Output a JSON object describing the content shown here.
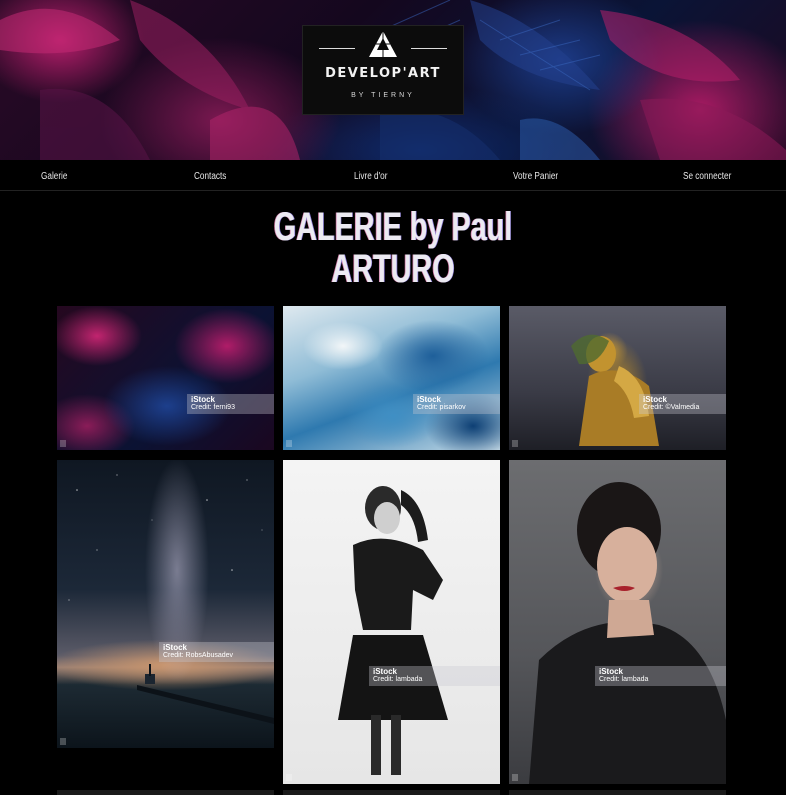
{
  "logo": {
    "title": "DEVELOP'ART",
    "subtitle": "BY TIERNY"
  },
  "nav": {
    "items": [
      {
        "label": "Galerie"
      },
      {
        "label": "Contacts"
      },
      {
        "label": "Livre d'or"
      },
      {
        "label": "Votre Panier"
      },
      {
        "label": "Se connecter"
      }
    ]
  },
  "page": {
    "title_line1": "GALERIE by Paul",
    "title_line2": "ARTURO"
  },
  "gallery": {
    "items": [
      {
        "credit_brand": "iStock",
        "credit_text": "Credit: ferni93"
      },
      {
        "credit_brand": "iStock",
        "credit_text": "Credit: pisarkov"
      },
      {
        "credit_brand": "iStock",
        "credit_text": "Credit: ©Valmedia"
      },
      {
        "credit_brand": "iStock",
        "credit_text": "Credit: RobsAbusadev"
      },
      {
        "credit_brand": "iStock",
        "credit_text": "Credit: lambada"
      },
      {
        "credit_brand": "iStock",
        "credit_text": "Credit: lambada"
      }
    ]
  }
}
